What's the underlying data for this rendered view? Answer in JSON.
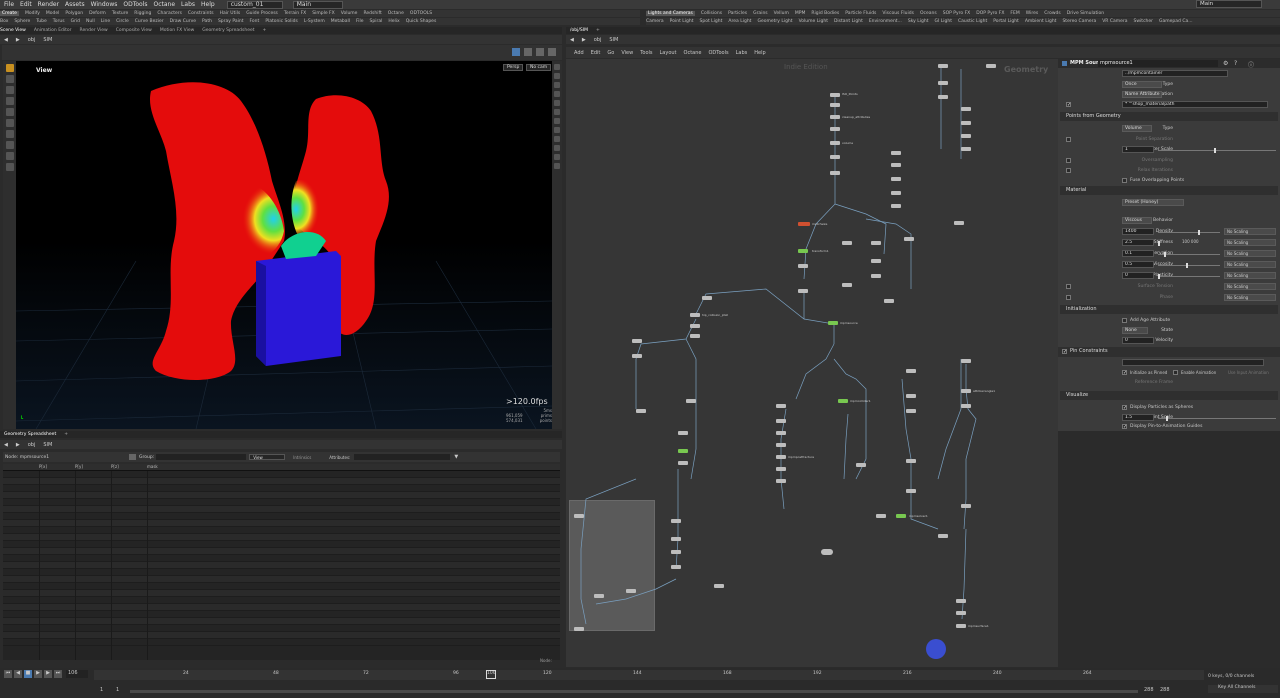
{
  "menu": [
    "File",
    "Edit",
    "Render",
    "Assets",
    "Windows",
    "ODTools",
    "Octane",
    "Labs",
    "Help"
  ],
  "desktop": "custom_01",
  "main_tab": "Main",
  "top_right_main": "Main",
  "shelf_left": [
    "Create",
    "Modify",
    "Model",
    "Polygon",
    "Deform",
    "Texture",
    "Rigging",
    "Characters",
    "Constraints",
    "Hair Utils",
    "Guide Process",
    "Terrain FX",
    "Simple FX",
    "Volume",
    "Redshift",
    "Octane",
    "ODTOOLS"
  ],
  "shelf_left_tools": [
    "Box",
    "Sphere",
    "Tube",
    "Torus",
    "Grid",
    "Null",
    "Line",
    "Circle",
    "Curve Bezier",
    "Draw Curve",
    "Path",
    "Spray Paint",
    "Font",
    "Platonic Solids",
    "L-System",
    "Metaball",
    "File",
    "Spiral",
    "Helix",
    "Quick Shapes"
  ],
  "shelf_right": [
    "Lights and Cameras",
    "Collisions",
    "Particles",
    "Grains",
    "Vellum",
    "MPM",
    "Rigid Bodies",
    "Particle Fluids",
    "Viscous Fluids",
    "Oceans",
    "SOP Pyro FX",
    "DOP Pyro FX",
    "FEM",
    "Wires",
    "Crowds",
    "Drive Simulation"
  ],
  "shelf_right_tools": [
    "Camera",
    "Point Light",
    "Spot Light",
    "Area Light",
    "Geometry Light",
    "Volume Light",
    "Distant Light",
    "Environment...",
    "Sky Light",
    "GI Light",
    "Caustic Light",
    "Portal Light",
    "Ambient Light",
    "Stereo Camera",
    "VR Camera",
    "Switcher",
    "Gamepad Ca..."
  ],
  "left_tabs": [
    "Scene View",
    "Animation Editor",
    "Render View",
    "Composite View",
    "Motion FX View",
    "Geometry Spreadsheet"
  ],
  "left_path": [
    "obj",
    "SIM"
  ],
  "viewport": {
    "label": "View",
    "camera": "Persp",
    "cam_menu": "No cam",
    "fps": ">120.0fps",
    "stats": [
      {
        "num": "",
        "label": "5ms"
      },
      {
        "num": "961,059",
        "label": "prims"
      },
      {
        "num": "574,031",
        "label": "points"
      }
    ]
  },
  "sheet_tabs": [
    "Geometry Spreadsheet"
  ],
  "sheet_path": [
    "obj",
    "SIM"
  ],
  "sheet": {
    "node": "Node: mpmsource1",
    "group_label": "Group:",
    "view": "View",
    "intrinsics": "Intrinsics",
    "attributes": "Attributes:",
    "columns": [
      "P[x]",
      "P[y]",
      "P[z]",
      "mask"
    ],
    "footer": "Node:"
  },
  "net_tabs": [
    "/obj/SIM"
  ],
  "net_path": [
    "obj",
    "SIM"
  ],
  "net_menu": [
    "Add",
    "Edit",
    "Go",
    "View",
    "Tools",
    "Layout",
    "Octane",
    "ODTools",
    "Labs",
    "Help"
  ],
  "net_watermark": [
    "Indie Edition",
    "Geometry"
  ],
  "params": {
    "node_type": "MPM Source",
    "node_name": "mpmsource1",
    "rows": [
      {
        "label": "MPM Container",
        "value": "../mpmcontainer"
      },
      {
        "label": "Emission Type",
        "value": "Once"
      },
      {
        "label": "Segmentation",
        "value": "Name Attribute"
      },
      {
        "label": "Attribute to Transfer",
        "value": "* ^shop_materialpath"
      }
    ],
    "sec_points": "Points from Geometry",
    "type": {
      "label": "Type",
      "value": "Volume"
    },
    "point_separation": "Point Separation",
    "jitter": {
      "label": "Jitter Scale",
      "value": "1"
    },
    "oversampling": "Oversampling",
    "relax": "Relax Iterations",
    "fuse": "Fuse Overlapping Points",
    "sec_material": "Material",
    "preset": {
      "label": "Material Preset",
      "value": "Preset (Honey)"
    },
    "behavior": {
      "label": "Behavior",
      "value": "Viscous"
    },
    "density": {
      "label": "Density",
      "value": "1400",
      "scale": "No Scaling"
    },
    "stiffness": {
      "label": "Stiffness",
      "value": "2.5",
      "extra": "100 000",
      "scale": "No Scaling"
    },
    "volume_pres": {
      "label": "Volume Preservation",
      "value": "0.1",
      "scale": "No Scaling"
    },
    "viscosity": {
      "label": "Viscosity",
      "value": "0.5",
      "scale": "No Scaling"
    },
    "plasticity": {
      "label": "Plasticity",
      "value": "0",
      "scale": "No Scaling"
    },
    "surface_tension": {
      "label": "Surface Tension",
      "scale": "No Scaling"
    },
    "phase": {
      "label": "Phase",
      "scale": "No Scaling"
    },
    "sec_init": "Initialization",
    "add_age": "Add Age Attribute",
    "state": {
      "label": "State",
      "value": "None"
    },
    "velocity": {
      "label": "Velocity",
      "value": "0"
    },
    "pin_constraints": "Pin Constraints",
    "point_group": "Point Group",
    "init_pinned": "Initialize as Pinned",
    "enable_anim": "Enable Animation",
    "use_input_anim": "Use Input Animation",
    "ref_frame": "Reference Frame",
    "sec_visualize": "Visualize",
    "display_spheres": "Display Particles as Spheres",
    "point_scale": {
      "label": "Point Scale",
      "value": "1.5"
    },
    "display_pin": "Display Pin-to-Animation Guides"
  },
  "timeline": {
    "frame": "106",
    "start": "1",
    "end_a": "288",
    "end_b": "288",
    "field_a": "1",
    "field_b": "1",
    "ticks": [
      "24",
      "48",
      "72",
      "96",
      "120",
      "144",
      "168",
      "192",
      "216",
      "240",
      "264"
    ],
    "keys": "0 keys, 0/0 channels",
    "channels": "Key All Channels"
  },
  "nodes": [
    [
      "ISO_Points",
      "cleanup_attributes",
      "volume"
    ],
    [
      "matchsize",
      "transform1",
      "mpmsource"
    ],
    [
      "hip_collision_ptat",
      "mpmcollider1",
      "mpmsolver1"
    ],
    [
      "attribwrangle1",
      "mpmpostfracture",
      "mpmsurface1"
    ]
  ],
  "colors": {
    "accent": "#c87820",
    "node": "#bdbdbd",
    "node_green": "#78c850",
    "node_orange": "#d05030",
    "wire": "#7aa0c0"
  }
}
